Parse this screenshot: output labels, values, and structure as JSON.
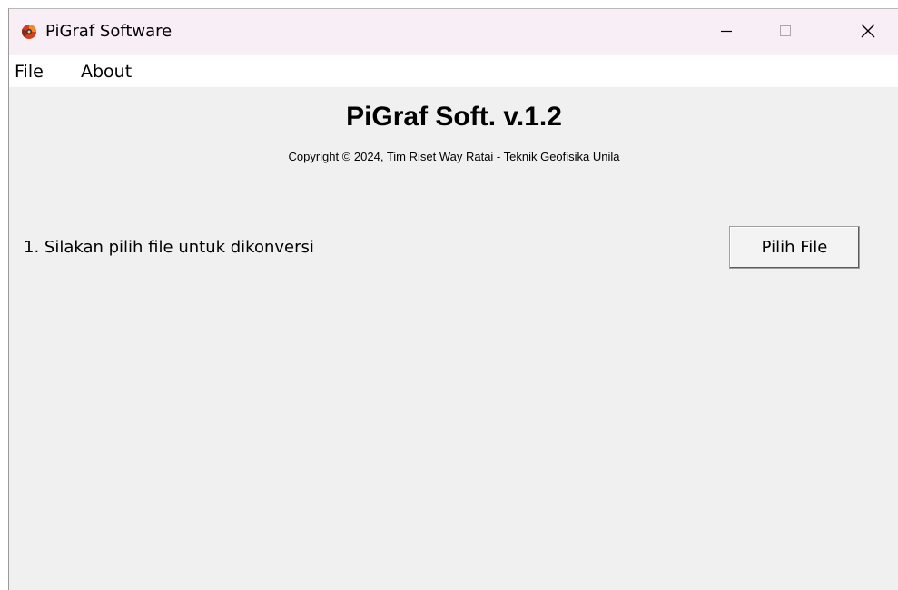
{
  "window": {
    "title": "PiGraf Software",
    "icon": "pigraf-app-icon",
    "controls": {
      "minimize": "minimize-icon",
      "maximize": "maximize-icon",
      "close": "close-icon"
    }
  },
  "menubar": {
    "items": [
      "File",
      "About"
    ]
  },
  "main": {
    "heading": "PiGraf Soft. v.1.2",
    "copyright": "Copyright © 2024, Tim Riset Way Ratai - Teknik Geofisika Unila",
    "instruction": "1. Silakan pilih file untuk dikonversi",
    "choose_file_button": "Pilih File"
  },
  "colors": {
    "titlebar_bg": "#f8eef6",
    "client_bg": "#f0f0f0",
    "icon_red": "#d2401e",
    "icon_dark": "#3a3a5a"
  }
}
